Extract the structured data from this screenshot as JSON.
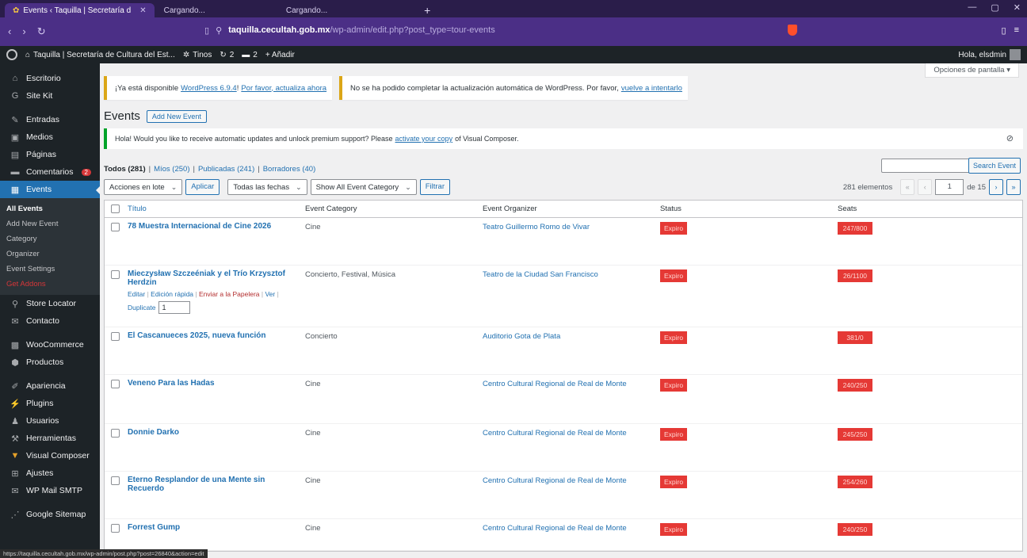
{
  "browser": {
    "tabs": [
      {
        "label": "Events ‹ Taquilla | Secretaría d",
        "active": true
      },
      {
        "label": "Cargando...",
        "active": false
      },
      {
        "label": "Cargando...",
        "active": false
      }
    ],
    "new_tab": "+",
    "url_host": "taquilla.cecultah.gob.mx",
    "url_path": "/wp-admin/edit.php?post_type=tour-events"
  },
  "adminbar": {
    "site": "Taquilla | Secretaría de Cultura del Est...",
    "themes": "Tinos",
    "updates": "2",
    "comments": "2",
    "add_new": "+ Añadir",
    "howdy": "Hola, elsdmin"
  },
  "sidebar": {
    "items": [
      {
        "label": "Escritorio",
        "icon": "dashboard-icon",
        "glyph": "⌂"
      },
      {
        "label": "Site Kit",
        "icon": "sitekit-icon",
        "glyph": "G"
      },
      {
        "label": "Entradas",
        "icon": "pin-icon",
        "glyph": "✎"
      },
      {
        "label": "Medios",
        "icon": "media-icon",
        "glyph": "▣"
      },
      {
        "label": "Páginas",
        "icon": "pages-icon",
        "glyph": "▤"
      },
      {
        "label": "Comentarios",
        "icon": "comments-icon",
        "glyph": "▬",
        "badge": "2"
      },
      {
        "label": "Events",
        "icon": "calendar-icon",
        "glyph": "▦",
        "current": true
      }
    ],
    "events_submenu": [
      {
        "label": "All Events",
        "current": true
      },
      {
        "label": "Add New Event"
      },
      {
        "label": "Category"
      },
      {
        "label": "Organizer"
      },
      {
        "label": "Event Settings"
      },
      {
        "label": "Get Addons",
        "red": true
      }
    ],
    "items2": [
      {
        "label": "Store Locator",
        "icon": "location-icon",
        "glyph": "⚲"
      },
      {
        "label": "Contacto",
        "icon": "mail-icon",
        "glyph": "✉"
      },
      {
        "label": "WooCommerce",
        "icon": "woocommerce-icon",
        "glyph": "▩"
      },
      {
        "label": "Productos",
        "icon": "products-icon",
        "glyph": "⬢"
      },
      {
        "label": "Apariencia",
        "icon": "brush-icon",
        "glyph": "✐"
      },
      {
        "label": "Plugins",
        "icon": "plugin-icon",
        "glyph": "⚡"
      },
      {
        "label": "Usuarios",
        "icon": "users-icon",
        "glyph": "♟"
      },
      {
        "label": "Herramientas",
        "icon": "wrench-icon",
        "glyph": "⚒"
      },
      {
        "label": "Visual Composer",
        "icon": "vc-icon",
        "glyph": "▼"
      },
      {
        "label": "Ajustes",
        "icon": "settings-icon",
        "glyph": "⊞"
      },
      {
        "label": "WP Mail SMTP",
        "icon": "smtp-icon",
        "glyph": "✉"
      },
      {
        "label": "Google Sitemap",
        "icon": "sitemap-icon",
        "glyph": "⋰"
      }
    ]
  },
  "main": {
    "screen_options": "Opciones de pantalla ▾",
    "notice1_text": "¡Ya está disponible",
    "notice1_link1": "WordPress 6.9.4",
    "notice1_mid": "!",
    "notice1_link2": "Por favor, actualiza ahora",
    "notice2_text": "No se ha podido completar la actualización automática de WordPress. Por favor,",
    "notice2_link": "vuelve a intentarlo",
    "title": "Events",
    "add_new": "Add New Event",
    "vc_notice_pre": "Hola! Would you like to receive automatic updates and unlock premium support? Please",
    "vc_notice_link": "activate your copy",
    "vc_notice_post": "of Visual Composer.",
    "views": {
      "all": "Todos (281)",
      "mine": "Míos (250)",
      "published": "Publicadas (241)",
      "drafts": "Borradores (40)"
    },
    "search_button": "Search Event",
    "bulk_actions": "Acciones en lote",
    "apply": "Aplicar",
    "dates": "Todas las fechas",
    "category_filter": "Show All Event Category",
    "filter": "Filtrar",
    "items_count": "281 elementos",
    "page_current": "1",
    "page_total": "de 15",
    "columns": {
      "title": "Título",
      "category": "Event Category",
      "organizer": "Event Organizer",
      "status": "Status",
      "seats": "Seats"
    },
    "rows": [
      {
        "title": "78 Muestra Internacional de Cine 2026",
        "category": "Cine",
        "organizer": "Teatro Guillermo Romo de Vivar",
        "status": "Expiro",
        "seats": "247/800"
      },
      {
        "title": "Mieczysław Szczeéniak y el Trío Krzysztof Herdzin",
        "category": "Concierto, Festival, Música",
        "organizer": "Teatro de la Ciudad San Francisco",
        "status": "Expiro",
        "seats": "26/1100",
        "actions": {
          "edit": "Editar",
          "quick": "Edición rápida",
          "trash": "Enviar a la Papelera",
          "view": "Ver",
          "duplicate": "Duplicate",
          "dup_value": "1"
        }
      },
      {
        "title": "El Cascanueces 2025, nueva función",
        "category": "Concierto",
        "organizer": "Auditorio Gota de Plata",
        "status": "Expiro",
        "seats": "381/0"
      },
      {
        "title": "Veneno Para las Hadas",
        "category": "Cine",
        "organizer": "Centro Cultural Regional de Real de Monte",
        "status": "Expiro",
        "seats": "240/250"
      },
      {
        "title": "Donnie Darko",
        "category": "Cine",
        "organizer": "Centro Cultural Regional de Real de Monte",
        "status": "Expiro",
        "seats": "245/250"
      },
      {
        "title": "Eterno Resplandor de una Mente sin Recuerdo",
        "category": "Cine",
        "organizer": "Centro Cultural Regional de Real de Monte",
        "status": "Expiro",
        "seats": "254/260"
      },
      {
        "title": "Forrest Gump",
        "category": "Cine",
        "organizer": "Centro Cultural Regional de Real de Monte",
        "status": "Expiro",
        "seats": "240/250"
      }
    ]
  },
  "statusbar": "https://taquilla.cecultah.gob.mx/wp-admin/post.php?post=26840&action=edit",
  "colors": {
    "accent": "#2271b1",
    "expired": "#e53935",
    "browser": "#4b2f86",
    "sidebar": "#1d2327"
  }
}
